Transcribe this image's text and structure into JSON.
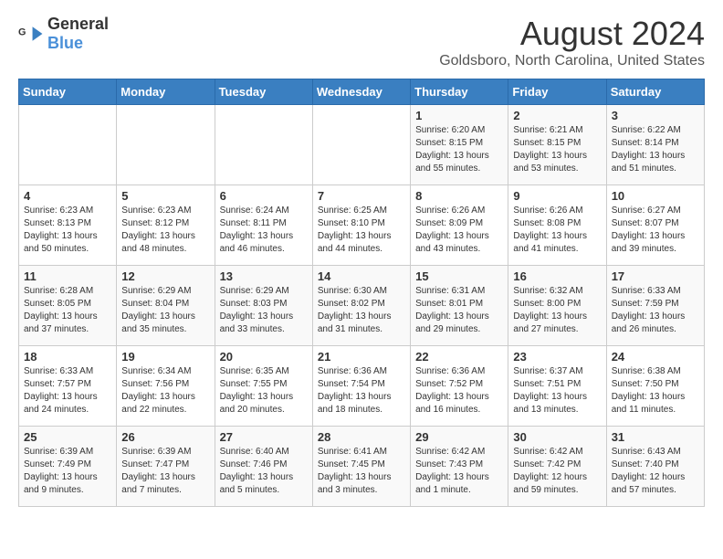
{
  "logo": {
    "general": "General",
    "blue": "Blue"
  },
  "title": "August 2024",
  "subtitle": "Goldsboro, North Carolina, United States",
  "days_of_week": [
    "Sunday",
    "Monday",
    "Tuesday",
    "Wednesday",
    "Thursday",
    "Friday",
    "Saturday"
  ],
  "weeks": [
    [
      {
        "day": "",
        "info": ""
      },
      {
        "day": "",
        "info": ""
      },
      {
        "day": "",
        "info": ""
      },
      {
        "day": "",
        "info": ""
      },
      {
        "day": "1",
        "info": "Sunrise: 6:20 AM\nSunset: 8:15 PM\nDaylight: 13 hours\nand 55 minutes."
      },
      {
        "day": "2",
        "info": "Sunrise: 6:21 AM\nSunset: 8:15 PM\nDaylight: 13 hours\nand 53 minutes."
      },
      {
        "day": "3",
        "info": "Sunrise: 6:22 AM\nSunset: 8:14 PM\nDaylight: 13 hours\nand 51 minutes."
      }
    ],
    [
      {
        "day": "4",
        "info": "Sunrise: 6:23 AM\nSunset: 8:13 PM\nDaylight: 13 hours\nand 50 minutes."
      },
      {
        "day": "5",
        "info": "Sunrise: 6:23 AM\nSunset: 8:12 PM\nDaylight: 13 hours\nand 48 minutes."
      },
      {
        "day": "6",
        "info": "Sunrise: 6:24 AM\nSunset: 8:11 PM\nDaylight: 13 hours\nand 46 minutes."
      },
      {
        "day": "7",
        "info": "Sunrise: 6:25 AM\nSunset: 8:10 PM\nDaylight: 13 hours\nand 44 minutes."
      },
      {
        "day": "8",
        "info": "Sunrise: 6:26 AM\nSunset: 8:09 PM\nDaylight: 13 hours\nand 43 minutes."
      },
      {
        "day": "9",
        "info": "Sunrise: 6:26 AM\nSunset: 8:08 PM\nDaylight: 13 hours\nand 41 minutes."
      },
      {
        "day": "10",
        "info": "Sunrise: 6:27 AM\nSunset: 8:07 PM\nDaylight: 13 hours\nand 39 minutes."
      }
    ],
    [
      {
        "day": "11",
        "info": "Sunrise: 6:28 AM\nSunset: 8:05 PM\nDaylight: 13 hours\nand 37 minutes."
      },
      {
        "day": "12",
        "info": "Sunrise: 6:29 AM\nSunset: 8:04 PM\nDaylight: 13 hours\nand 35 minutes."
      },
      {
        "day": "13",
        "info": "Sunrise: 6:29 AM\nSunset: 8:03 PM\nDaylight: 13 hours\nand 33 minutes."
      },
      {
        "day": "14",
        "info": "Sunrise: 6:30 AM\nSunset: 8:02 PM\nDaylight: 13 hours\nand 31 minutes."
      },
      {
        "day": "15",
        "info": "Sunrise: 6:31 AM\nSunset: 8:01 PM\nDaylight: 13 hours\nand 29 minutes."
      },
      {
        "day": "16",
        "info": "Sunrise: 6:32 AM\nSunset: 8:00 PM\nDaylight: 13 hours\nand 27 minutes."
      },
      {
        "day": "17",
        "info": "Sunrise: 6:33 AM\nSunset: 7:59 PM\nDaylight: 13 hours\nand 26 minutes."
      }
    ],
    [
      {
        "day": "18",
        "info": "Sunrise: 6:33 AM\nSunset: 7:57 PM\nDaylight: 13 hours\nand 24 minutes."
      },
      {
        "day": "19",
        "info": "Sunrise: 6:34 AM\nSunset: 7:56 PM\nDaylight: 13 hours\nand 22 minutes."
      },
      {
        "day": "20",
        "info": "Sunrise: 6:35 AM\nSunset: 7:55 PM\nDaylight: 13 hours\nand 20 minutes."
      },
      {
        "day": "21",
        "info": "Sunrise: 6:36 AM\nSunset: 7:54 PM\nDaylight: 13 hours\nand 18 minutes."
      },
      {
        "day": "22",
        "info": "Sunrise: 6:36 AM\nSunset: 7:52 PM\nDaylight: 13 hours\nand 16 minutes."
      },
      {
        "day": "23",
        "info": "Sunrise: 6:37 AM\nSunset: 7:51 PM\nDaylight: 13 hours\nand 13 minutes."
      },
      {
        "day": "24",
        "info": "Sunrise: 6:38 AM\nSunset: 7:50 PM\nDaylight: 13 hours\nand 11 minutes."
      }
    ],
    [
      {
        "day": "25",
        "info": "Sunrise: 6:39 AM\nSunset: 7:49 PM\nDaylight: 13 hours\nand 9 minutes."
      },
      {
        "day": "26",
        "info": "Sunrise: 6:39 AM\nSunset: 7:47 PM\nDaylight: 13 hours\nand 7 minutes."
      },
      {
        "day": "27",
        "info": "Sunrise: 6:40 AM\nSunset: 7:46 PM\nDaylight: 13 hours\nand 5 minutes."
      },
      {
        "day": "28",
        "info": "Sunrise: 6:41 AM\nSunset: 7:45 PM\nDaylight: 13 hours\nand 3 minutes."
      },
      {
        "day": "29",
        "info": "Sunrise: 6:42 AM\nSunset: 7:43 PM\nDaylight: 13 hours\nand 1 minute."
      },
      {
        "day": "30",
        "info": "Sunrise: 6:42 AM\nSunset: 7:42 PM\nDaylight: 12 hours\nand 59 minutes."
      },
      {
        "day": "31",
        "info": "Sunrise: 6:43 AM\nSunset: 7:40 PM\nDaylight: 12 hours\nand 57 minutes."
      }
    ]
  ]
}
